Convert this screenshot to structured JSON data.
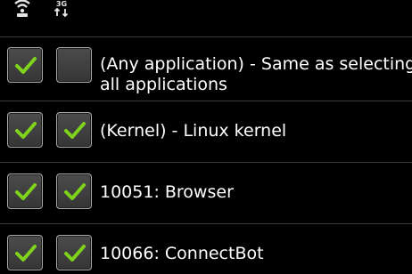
{
  "header": {
    "wifi_icon": "wifi-icon",
    "network_icon": "3g-data-icon",
    "network_label": "3G"
  },
  "colors": {
    "background": "#000000",
    "check_green": "#7fd31a",
    "checkbox_border": "#a9a9a9",
    "divider": "#3a3a3a",
    "text": "#ffffff"
  },
  "apps": [
    {
      "label_line1": "(Any application) - Same as selecting",
      "label_line2": "all applications",
      "wifi_checked": true,
      "network_checked": false
    },
    {
      "label_line1": "(Kernel) - Linux kernel",
      "label_line2": "",
      "wifi_checked": true,
      "network_checked": true
    },
    {
      "label_line1": "10051: Browser",
      "label_line2": "",
      "wifi_checked": true,
      "network_checked": true
    },
    {
      "label_line1": "10066: ConnectBot",
      "label_line2": "",
      "wifi_checked": true,
      "network_checked": true
    }
  ]
}
